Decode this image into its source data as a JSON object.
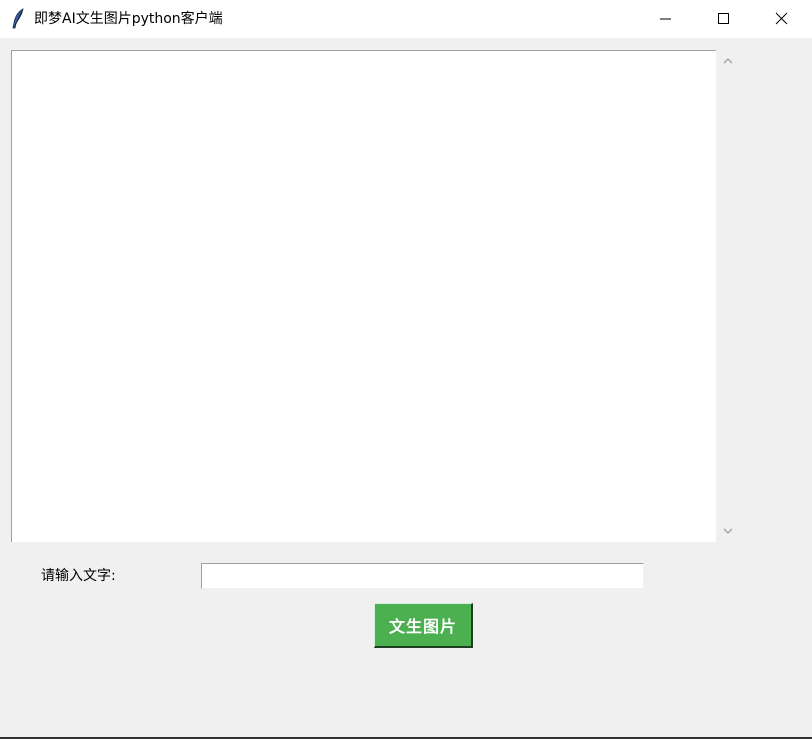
{
  "window": {
    "title": "即梦AI文生图片python客户端",
    "icon": "feather-icon",
    "controls": [
      "minimize-icon",
      "maximize-icon",
      "close-icon"
    ]
  },
  "output_area": {
    "content": ""
  },
  "scrollbar": {
    "up_icon": "chevron-up-icon",
    "down_icon": "chevron-down-icon"
  },
  "form": {
    "prompt_label": "请输入文字:",
    "prompt_value": "",
    "generate_button_label": "文生图片"
  },
  "colors": {
    "button_bg": "#4caf50",
    "window_bg": "#f0f0f0"
  }
}
